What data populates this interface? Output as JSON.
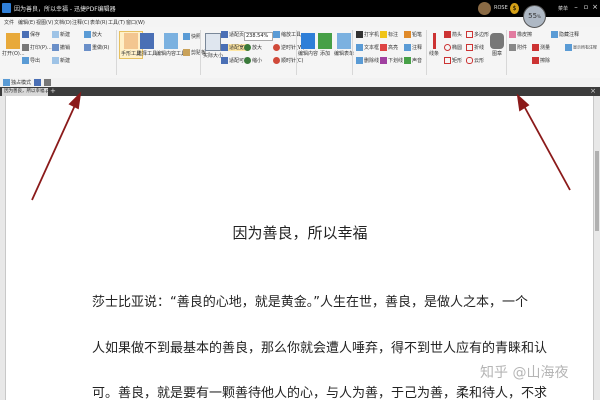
{
  "window": {
    "title": "因为善良，所以幸福 - 迅捷PDF编辑器",
    "user_name": "ROSE",
    "speed_value": "55",
    "speed_unit": "%",
    "top_right_label": "菜单"
  },
  "menu": [
    "文件",
    "编辑(E)",
    "视图(V)",
    "文档(D)",
    "注释(C)",
    "表单(R)",
    "工具(T)",
    "窗口(W)"
  ],
  "ribbon": {
    "open": "打开(O)...",
    "save": "保存",
    "print": "打印(P)...",
    "export": "导出",
    "undo": "撤销",
    "redo": "重做(R)",
    "new": "新建",
    "zoom_in": "放大",
    "zoom_out": "缩小",
    "hand_tool": "手形工具",
    "select_text": "选择工具",
    "edit_content": "编辑内容工具",
    "snapshot": "快照",
    "clipboard": "剪贴板",
    "actual_size": "实际大小",
    "fit_page": "适配页面",
    "fit_width": "适配宽度",
    "fit_visible": "适配可视",
    "zoom_value": "238.54%",
    "zoom_tool": "缩放工具",
    "rotate_ccw": "逆时针(W)",
    "rotate_cw": "顺时针(C)",
    "edit_form": "编辑内容",
    "add": "添加",
    "edit_tools": "编辑表单",
    "typewriter": "打字机",
    "textbox": "文本框",
    "note": "标注",
    "highlight": "高亮",
    "underline": "下划线",
    "strikeout": "删除线",
    "callout": "注释",
    "measure": "测量",
    "line": "线条",
    "rectangle": "矩形",
    "ellipse": "椭圆",
    "polygon": "多边形",
    "cloud": "云形",
    "polyline": "折线",
    "stamp": "图章",
    "eraser": "橡皮擦",
    "arrow": "箭头",
    "pencil": "铅笔",
    "attachment": "附件",
    "sound": "声音",
    "erase": "擦除",
    "hide_anno": "隐藏注释",
    "show_anno": "显示所有注释"
  },
  "quickbar": {
    "mode": "独占模式"
  },
  "tab": {
    "label": "因为善良，所以幸福.p...",
    "close": "×",
    "add": "+"
  },
  "document": {
    "title": "因为善良，所以幸福",
    "lines": [
      "莎士比亚说：“善良的心地，就是黄金。”人生在世，善良，是做人之本，一个",
      "人如果做不到最基本的善良，那么你就会遭人唾弃，得不到世人应有的青睐和认",
      "可。善良，就是要有一颗善待他人的心，与人为善，于己为善，柔和待人，不求"
    ]
  },
  "watermark": "知乎 @山海夜",
  "colors": {
    "titlebar": "#000000",
    "arrow": "#8b1a1a",
    "accent": "#2f7fd8"
  }
}
